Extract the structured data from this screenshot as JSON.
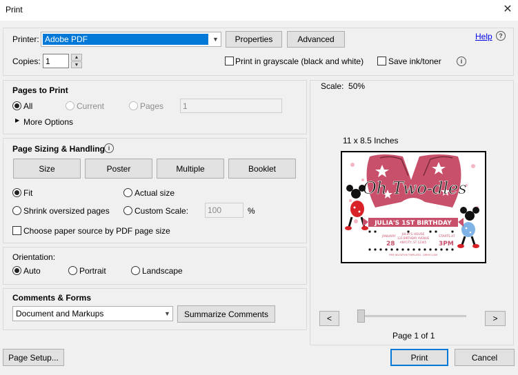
{
  "window": {
    "title": "Print",
    "close_glyph": "✕"
  },
  "printer": {
    "label": "Printer:",
    "selected": "Adobe PDF",
    "properties_label": "Properties",
    "advanced_label": "Advanced",
    "help_label": "Help",
    "copies_label": "Copies:",
    "copies_value": "1",
    "grayscale_label": "Print in grayscale (black and white)",
    "save_ink_label": "Save ink/toner"
  },
  "pages": {
    "title": "Pages to Print",
    "all_label": "All",
    "current_label": "Current",
    "pages_label": "Pages",
    "pages_value": "1",
    "more_options_label": "More Options"
  },
  "sizing": {
    "title": "Page Sizing & Handling",
    "tabs": [
      "Size",
      "Poster",
      "Multiple",
      "Booklet"
    ],
    "fit_label": "Fit",
    "actual_size_label": "Actual size",
    "shrink_label": "Shrink oversized pages",
    "custom_scale_label": "Custom Scale:",
    "custom_scale_value": "100",
    "percent_sign": "%",
    "paper_source_label": "Choose paper source by PDF page size"
  },
  "orientation": {
    "title": "Orientation:",
    "auto_label": "Auto",
    "portrait_label": "Portrait",
    "landscape_label": "Landscape"
  },
  "comments": {
    "title": "Comments & Forms",
    "selected": "Document and Markups",
    "summarize_label": "Summarize Comments"
  },
  "preview": {
    "scale_text": "Scale:  50%",
    "page_size_text": "11 x 8.5 Inches",
    "prev_glyph": "<",
    "next_glyph": ">",
    "page_indicator": "Page 1 of 1",
    "invite": {
      "headline": "Oh Two-dles",
      "banner": "JULIA'S 1ST BIRTHDAY",
      "month": "JANUARY",
      "day": "28",
      "place": "JULIA'S HOUSE",
      "address1": "123 BIRTHDAY AVENUE",
      "address2": "ANYCITY, ST 12345",
      "starts_label": "STARTS AT",
      "time": "3PM",
      "footer": "FREE INVITATION TEMPLATES - DREVIO.COM"
    }
  },
  "footer": {
    "page_setup_label": "Page Setup...",
    "print_label": "Print",
    "cancel_label": "Cancel"
  },
  "colors": {
    "accent": "#0078d7",
    "invite_pink": "#c9506a",
    "invite_red": "#d82228"
  }
}
